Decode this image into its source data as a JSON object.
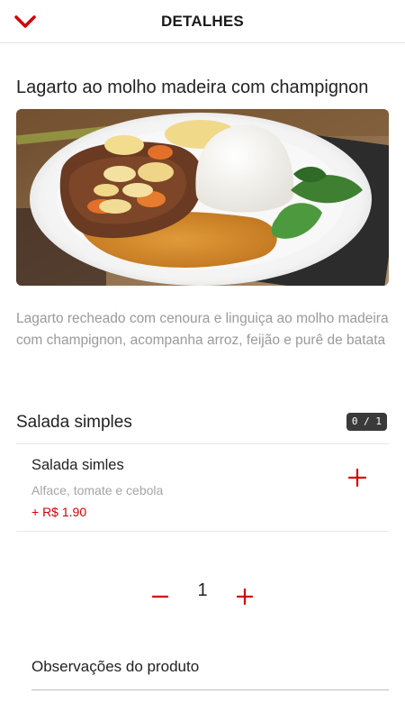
{
  "header": {
    "title": "DETALHES",
    "back_icon": "chevron-down-icon",
    "accent_color": "#d40000"
  },
  "product": {
    "title": "Lagarto ao molho madeira com champignon",
    "image_alt": "Lagarto ao molho madeira com champignon",
    "description": "Lagarto recheado com cenoura e linguiça ao molho madeira com champignon, acompanha arroz, feijão e purê de batata"
  },
  "extras_section": {
    "title": "Salada simples",
    "count_badge": "0 / 1",
    "options": [
      {
        "name": "Salada simles",
        "detail": "Alface, tomate e cebola",
        "price": "+ R$ 1.90",
        "add_icon": "plus-icon"
      }
    ]
  },
  "quantity": {
    "value": "1",
    "minus_icon": "minus-icon",
    "plus_icon": "plus-icon"
  },
  "notes": {
    "label": "Observações do produto",
    "value": ""
  }
}
